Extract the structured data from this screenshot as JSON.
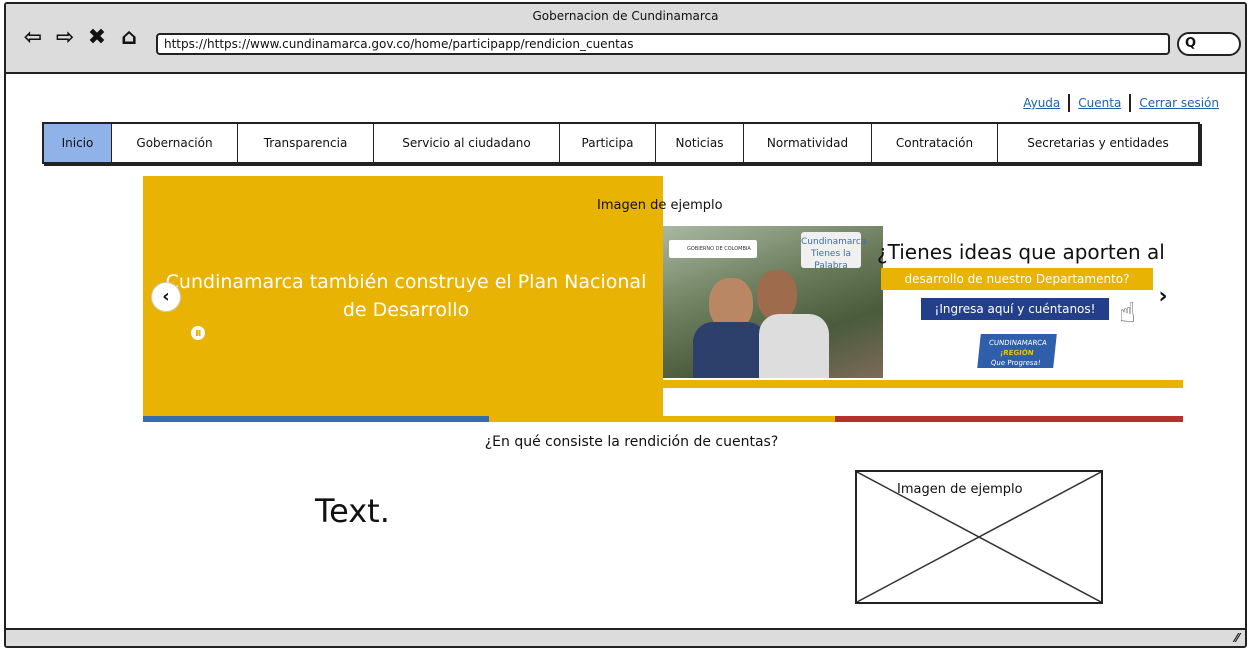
{
  "window": {
    "title": "Gobernacion de Cundinamarca",
    "address": "https://https://www.cundinamarca.gov.co/home/participapp/rendicion_cuentas",
    "nav_icons": [
      "back-arrow-icon",
      "forward-arrow-icon",
      "close-icon",
      "home-icon"
    ],
    "nav_glyphs": [
      "⇦",
      "⇨",
      "✖",
      "⌂"
    ],
    "search_glyph": "Q"
  },
  "toplinks": {
    "help": "Ayuda",
    "account": "Cuenta",
    "logout": "Cerrar sesión"
  },
  "nav": {
    "items": [
      {
        "label": "Inicio",
        "active": true
      },
      {
        "label": "Gobernación"
      },
      {
        "label": "Transparencia"
      },
      {
        "label": "Servicio al ciudadano"
      },
      {
        "label": "Participa"
      },
      {
        "label": "Noticias"
      },
      {
        "label": "Normatividad"
      },
      {
        "label": "Contratación"
      },
      {
        "label": "Secretarias y entidades"
      }
    ]
  },
  "carousel": {
    "caption": "Imagen de ejemplo",
    "slide_text": "Cundinamarca también construye el Plan Nacional de Desarrollo",
    "prev_glyph": "‹",
    "next_glyph": "›",
    "banner": {
      "gov_badge": "GOBIERNO DE COLOMBIA",
      "tienes": "Cundinamarca Tienes la Palabra",
      "headline": "¿Tienes ideas que aporten al",
      "band": "desarrollo de nuestro Departamento?",
      "cta": "¡Ingresa aquí y cuéntanos!",
      "logo_line1": "CUNDINAMARCA",
      "logo_line2": "¡REGIÓN",
      "logo_line3": "Que Progresa!"
    },
    "bar_colors": [
      "#3a6bb0",
      "#e9b303",
      "#b5312c"
    ]
  },
  "content": {
    "question": "¿En qué consiste la rendición de cuentas?",
    "text": "Text.",
    "image_caption": "Imagen de ejemplo"
  },
  "colors": {
    "accent_blue": "#8fb3e8",
    "yellow": "#e9b303",
    "dark_blue": "#243f8a",
    "red": "#b5312c"
  }
}
